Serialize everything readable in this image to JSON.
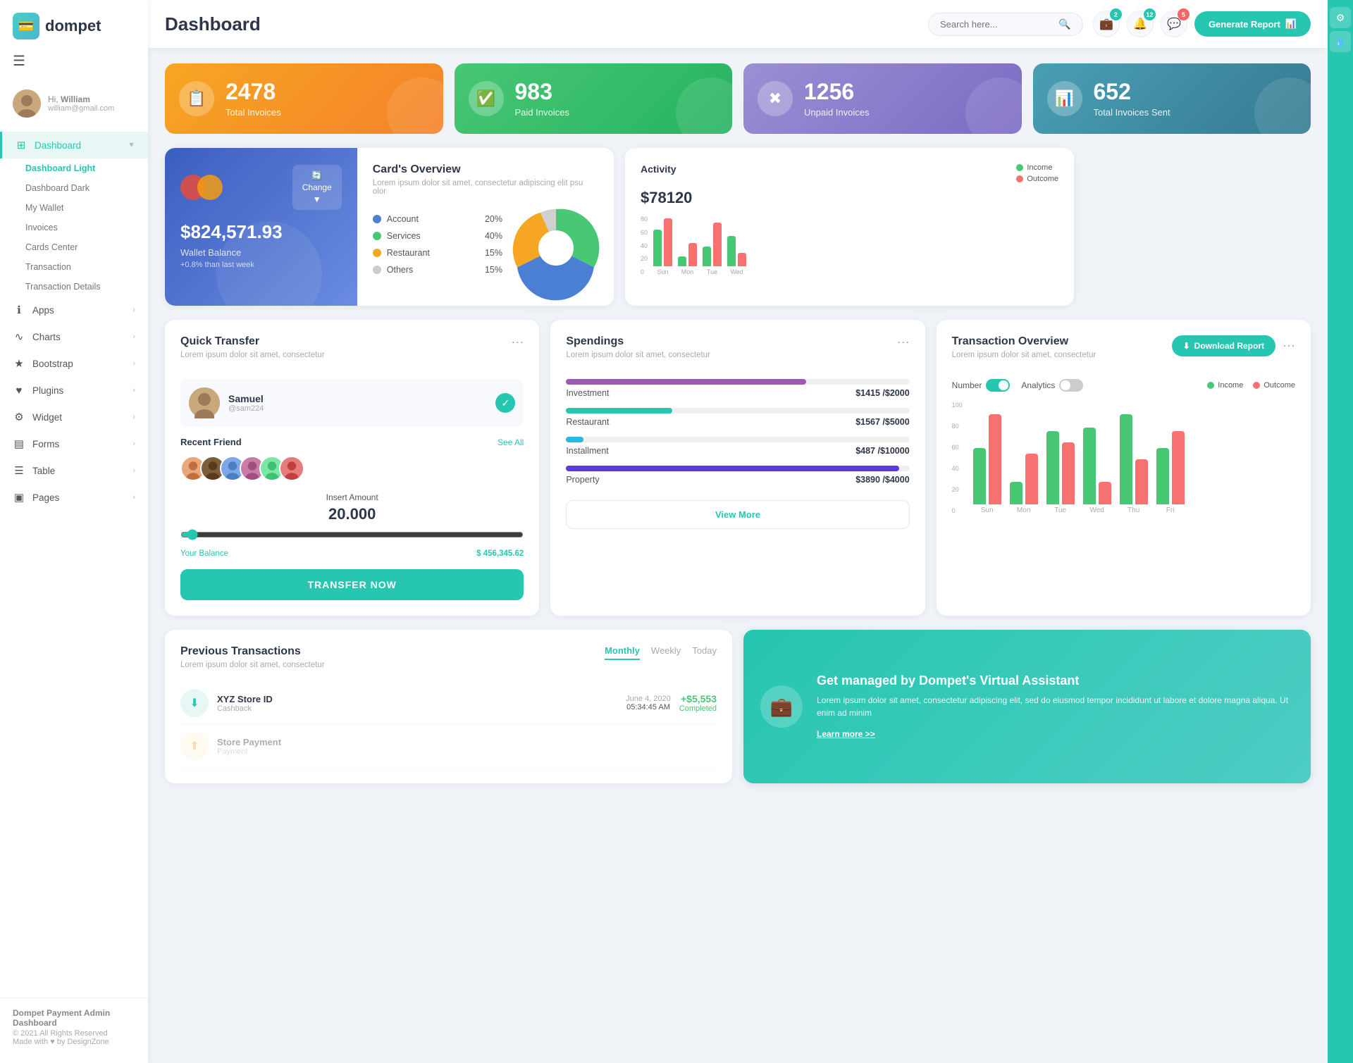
{
  "app": {
    "name": "dompet",
    "logo_icon": "💳"
  },
  "topbar": {
    "title": "Dashboard",
    "search_placeholder": "Search here...",
    "notifications_count": "2",
    "bell_count": "12",
    "chat_count": "5",
    "generate_btn": "Generate Report"
  },
  "sidebar": {
    "user": {
      "greeting": "Hi,",
      "name": "William",
      "email": "william@gmail.com"
    },
    "main_items": [
      {
        "id": "dashboard",
        "label": "Dashboard",
        "icon": "⊞",
        "active": true,
        "has_arrow": true
      },
      {
        "id": "apps",
        "label": "Apps",
        "icon": "ℹ",
        "active": false,
        "has_arrow": true
      },
      {
        "id": "charts",
        "label": "Charts",
        "icon": "∿",
        "active": false,
        "has_arrow": true
      },
      {
        "id": "bootstrap",
        "label": "Bootstrap",
        "icon": "★",
        "active": false,
        "has_arrow": true
      },
      {
        "id": "plugins",
        "label": "Plugins",
        "icon": "♥",
        "active": false,
        "has_arrow": true
      },
      {
        "id": "widget",
        "label": "Widget",
        "icon": "⚙",
        "active": false,
        "has_arrow": true
      },
      {
        "id": "forms",
        "label": "Forms",
        "icon": "▤",
        "active": false,
        "has_arrow": true
      },
      {
        "id": "table",
        "label": "Table",
        "icon": "☰",
        "active": false,
        "has_arrow": true
      },
      {
        "id": "pages",
        "label": "Pages",
        "icon": "▣",
        "active": false,
        "has_arrow": true
      }
    ],
    "sub_items": [
      {
        "label": "Dashboard Light",
        "active": true
      },
      {
        "label": "Dashboard Dark",
        "active": false
      },
      {
        "label": "My Wallet",
        "active": false
      },
      {
        "label": "Invoices",
        "active": false
      },
      {
        "label": "Cards Center",
        "active": false
      },
      {
        "label": "Transaction",
        "active": false
      },
      {
        "label": "Transaction Details",
        "active": false
      }
    ],
    "footer": {
      "brand": "Dompet Payment Admin Dashboard",
      "year": "© 2021 All Rights Reserved",
      "made": "Made with ♥ by DesignZone"
    }
  },
  "stats": [
    {
      "id": "total-invoices",
      "num": "2478",
      "label": "Total Invoices",
      "color": "orange",
      "icon": "📋"
    },
    {
      "id": "paid-invoices",
      "num": "983",
      "label": "Paid Invoices",
      "color": "green",
      "icon": "✅"
    },
    {
      "id": "unpaid-invoices",
      "num": "1256",
      "label": "Unpaid Invoices",
      "color": "purple",
      "icon": "✖"
    },
    {
      "id": "total-sent",
      "num": "652",
      "label": "Total Invoices Sent",
      "color": "teal",
      "icon": "📊"
    }
  ],
  "wallet": {
    "balance": "$824,571.93",
    "label": "Wallet Balance",
    "change": "+0.8% than last week",
    "change_btn": "Change"
  },
  "cards_overview": {
    "title": "Card's Overview",
    "subtitle": "Lorem ipsum dolor sit amet, consectetur adipiscing elit psu olor",
    "items": [
      {
        "label": "Account",
        "pct": "20%",
        "color": "#4a7fd4"
      },
      {
        "label": "Services",
        "pct": "40%",
        "color": "#48c774"
      },
      {
        "label": "Restaurant",
        "pct": "15%",
        "color": "#f6a623"
      },
      {
        "label": "Others",
        "pct": "15%",
        "color": "#ccc"
      }
    ],
    "pie": [
      {
        "label": "Account",
        "value": 20,
        "color": "#4a7fd4"
      },
      {
        "label": "Services",
        "value": 40,
        "color": "#48c774"
      },
      {
        "label": "Restaurant",
        "value": 15,
        "color": "#f6a623"
      },
      {
        "label": "Others",
        "value": 15,
        "color": "#ccc"
      }
    ]
  },
  "activity": {
    "title": "Activity",
    "amount": "$78120",
    "income_label": "Income",
    "outcome_label": "Outcome",
    "income_color": "#48c774",
    "outcome_color": "#f87171",
    "bars": [
      {
        "day": "Sun",
        "income": 55,
        "outcome": 70
      },
      {
        "day": "Mon",
        "income": 15,
        "outcome": 35
      },
      {
        "day": "Tue",
        "income": 30,
        "outcome": 65
      },
      {
        "day": "Wed",
        "income": 45,
        "outcome": 20
      }
    ],
    "y_labels": [
      "80",
      "60",
      "40",
      "20",
      "0"
    ]
  },
  "quick_transfer": {
    "title": "Quick Transfer",
    "subtitle": "Lorem ipsum dolor sit amet, consectetur",
    "person": {
      "name": "Samuel",
      "handle": "@sam224",
      "avatar_color": "#c9a87c"
    },
    "recent_label": "Recent Friend",
    "see_all": "See All",
    "friends": [
      {
        "color": "#e8a87c"
      },
      {
        "color": "#a87c5e"
      },
      {
        "color": "#7ca8e8"
      },
      {
        "color": "#c87ca8"
      },
      {
        "color": "#7ce8a8"
      },
      {
        "color": "#e87c7c"
      }
    ],
    "amount_label": "Insert Amount",
    "amount": "20.000",
    "balance_label": "Your Balance",
    "balance": "$ 456,345.62",
    "transfer_btn": "TRANSFER NOW"
  },
  "spendings": {
    "title": "Spendings",
    "subtitle": "Lorem ipsum dolor sit amet, consectetur",
    "items": [
      {
        "label": "Investment",
        "amount": "$1415",
        "max": "$2000",
        "pct": 70,
        "color": "#9b59b6"
      },
      {
        "label": "Restaurant",
        "amount": "$1567",
        "max": "$5000",
        "pct": 31,
        "color": "#26c6b0"
      },
      {
        "label": "Installment",
        "amount": "$487",
        "max": "$10000",
        "pct": 5,
        "color": "#26b8e0"
      },
      {
        "label": "Property",
        "amount": "$3890",
        "max": "$4000",
        "pct": 97,
        "color": "#5c3bdb"
      }
    ],
    "view_more_btn": "View More"
  },
  "transaction_overview": {
    "title": "Transaction Overview",
    "subtitle": "Lorem ipsum dolor sit amet, consectetur",
    "download_btn": "Download Report",
    "number_label": "Number",
    "analytics_label": "Analytics",
    "income_label": "Income",
    "outcome_label": "Outcome",
    "bars": [
      {
        "day": "Sun",
        "income": 50,
        "outcome": 80
      },
      {
        "day": "Mon",
        "income": 20,
        "outcome": 45
      },
      {
        "day": "Tue",
        "income": 65,
        "outcome": 55
      },
      {
        "day": "Wed",
        "income": 68,
        "outcome": 20
      },
      {
        "day": "Thu",
        "income": 80,
        "outcome": 40
      },
      {
        "day": "Fri",
        "income": 50,
        "outcome": 65
      }
    ],
    "y_labels": [
      "100",
      "80",
      "60",
      "40",
      "20",
      "0"
    ]
  },
  "previous_transactions": {
    "title": "Previous Transactions",
    "subtitle": "Lorem ipsum dolor sit amet, consectetur",
    "tabs": [
      "Monthly",
      "Weekly",
      "Today"
    ],
    "active_tab": "Monthly",
    "items": [
      {
        "name": "XYZ Store ID",
        "type": "Cashback",
        "date": "June 4, 2020",
        "time": "05:34:45 AM",
        "amount": "+$5,553",
        "status": "Completed",
        "icon": "⬇",
        "icon_color": "#26c6b0"
      }
    ]
  },
  "virtual_assistant": {
    "title": "Get managed by Dompet's Virtual Assistant",
    "text": "Lorem ipsum dolor sit amet, consectetur adipiscing elit, sed do eiusmod tempor incididunt ut labore et dolore magna aliqua. Ut enim ad minim",
    "link": "Learn more >>"
  }
}
